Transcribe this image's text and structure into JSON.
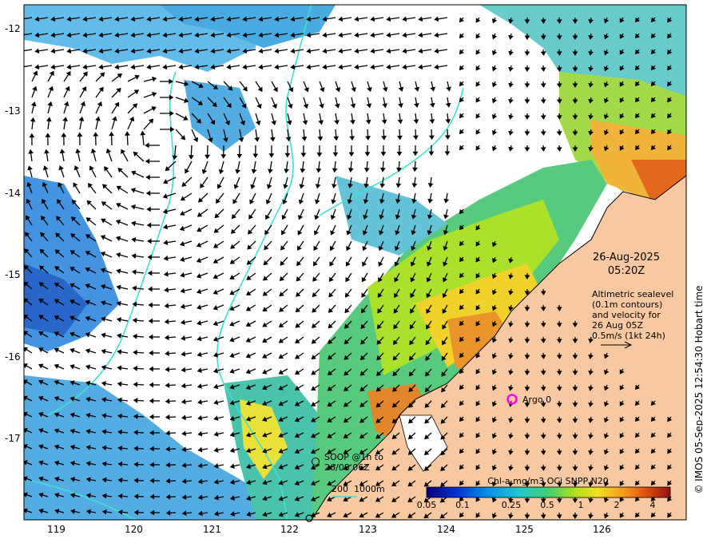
{
  "map": {
    "lat_labels": [
      "-12",
      "-13",
      "-14",
      "-15",
      "-16",
      "-17"
    ],
    "lon_labels": [
      "119",
      "120",
      "121",
      "122",
      "123",
      "124",
      "125",
      "126"
    ],
    "date": "26-Aug-2025",
    "time": "05:20Z",
    "legend_lines": [
      "Altimetric sealevel",
      "(0.1m contours)",
      "and velocity for",
      "26 Aug 05Z",
      "0.5m/s (1kt 24h)"
    ],
    "argo_label": "Argo 0",
    "soop_lines": [
      "SOOP @1h to",
      "26/08 06Z"
    ],
    "depth_label": "200  1000m",
    "colorbar_title": "Chl-a mg/m3 OCi SNPP N20",
    "colorbar_ticks": [
      "0.05",
      "0.1",
      "0.25",
      "0.5",
      "1",
      "2",
      "4"
    ],
    "credit": "© IMOS 05-Sep-2025 12:54:30 Hobart time",
    "colors": {
      "land": "#f8c9a0",
      "contour": "#40e0d0",
      "argo": "#ff00ff",
      "arrow": "#000000"
    }
  }
}
